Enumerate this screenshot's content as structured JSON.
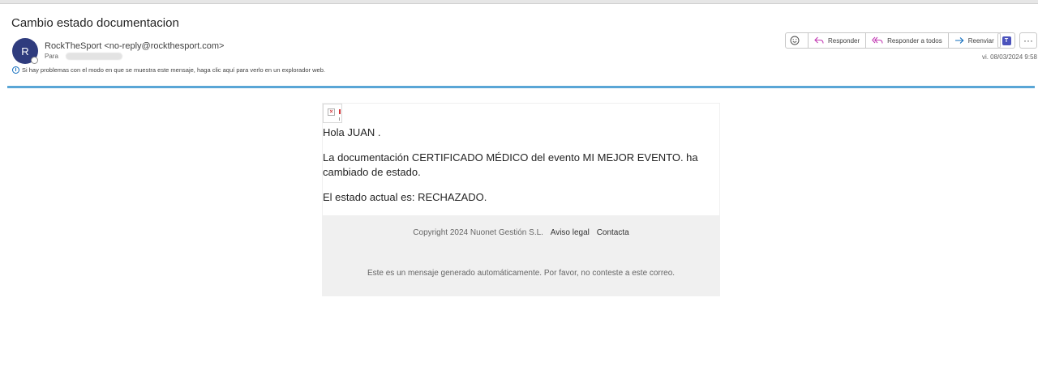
{
  "message": {
    "subject": "Cambio estado documentacion",
    "avatar_initial": "R",
    "sender": "RockTheSport <no-reply@rockthesport.com>",
    "to_label": "Para",
    "info_notice": "Si hay problemas con el modo en que se muestra este mensaje, haga clic aquí para verlo en un explorador web.",
    "date": "vi. 08/03/2024 9:58"
  },
  "actions": {
    "reply": "Responder",
    "reply_all": "Responder a todos",
    "forward": "Reenviar",
    "emoji_icon": "emoji-icon",
    "teams_icon": "teams-icon",
    "more_icon": "more-icon",
    "more_glyph": "···",
    "teams_glyph": "T"
  },
  "email": {
    "greeting": "Hola JUAN .",
    "paragraph": "La documentación CERTIFICADO MÉDICO del evento MI MEJOR EVENTO. ha cambiado de estado.",
    "status": "El estado actual es: RECHAZADO.",
    "footer": {
      "copyright": "Copyright 2024 Nuonet Gestión S.L.",
      "legal": "Aviso legal",
      "contact": "Contacta",
      "auto_message": "Este es un mensaje generado automáticamente. Por favor, no conteste a este correo."
    }
  },
  "colors": {
    "accent": "#5aa6d6",
    "avatar": "#2f3c7e",
    "reply_icon": "#c239b3",
    "forward_icon": "#0f6cbd"
  }
}
